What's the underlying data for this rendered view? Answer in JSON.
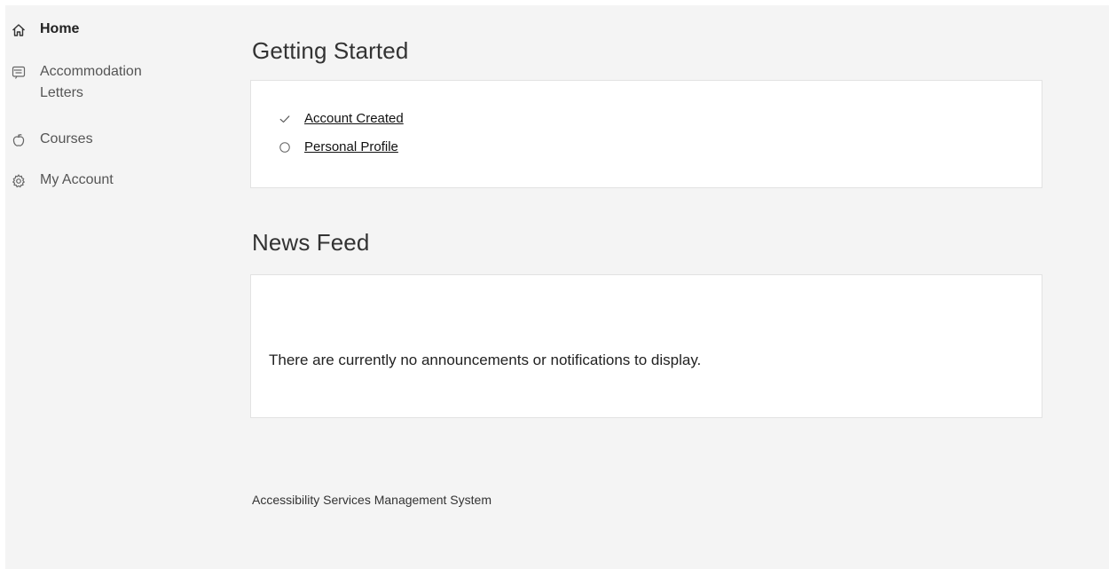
{
  "sidebar": {
    "items": [
      {
        "label": "Home",
        "icon": "home-icon"
      },
      {
        "label": "Accommodation Letters",
        "icon": "message-icon"
      },
      {
        "label": "Courses",
        "icon": "apple-icon"
      },
      {
        "label": "My Account",
        "icon": "gear-icon"
      }
    ]
  },
  "getting_started": {
    "title": "Getting Started",
    "items": [
      {
        "label": "Account Created",
        "status": "done"
      },
      {
        "label": "Personal Profile",
        "status": "pending"
      }
    ]
  },
  "news_feed": {
    "title": "News Feed",
    "empty_message": "There are currently no announcements or notifications to display."
  },
  "footer": {
    "text": "Accessibility Services Management System"
  },
  "colors": {
    "background": "#f4f4f4",
    "card": "#ffffff",
    "card_border": "#e2e2e2",
    "text": "#222222"
  }
}
